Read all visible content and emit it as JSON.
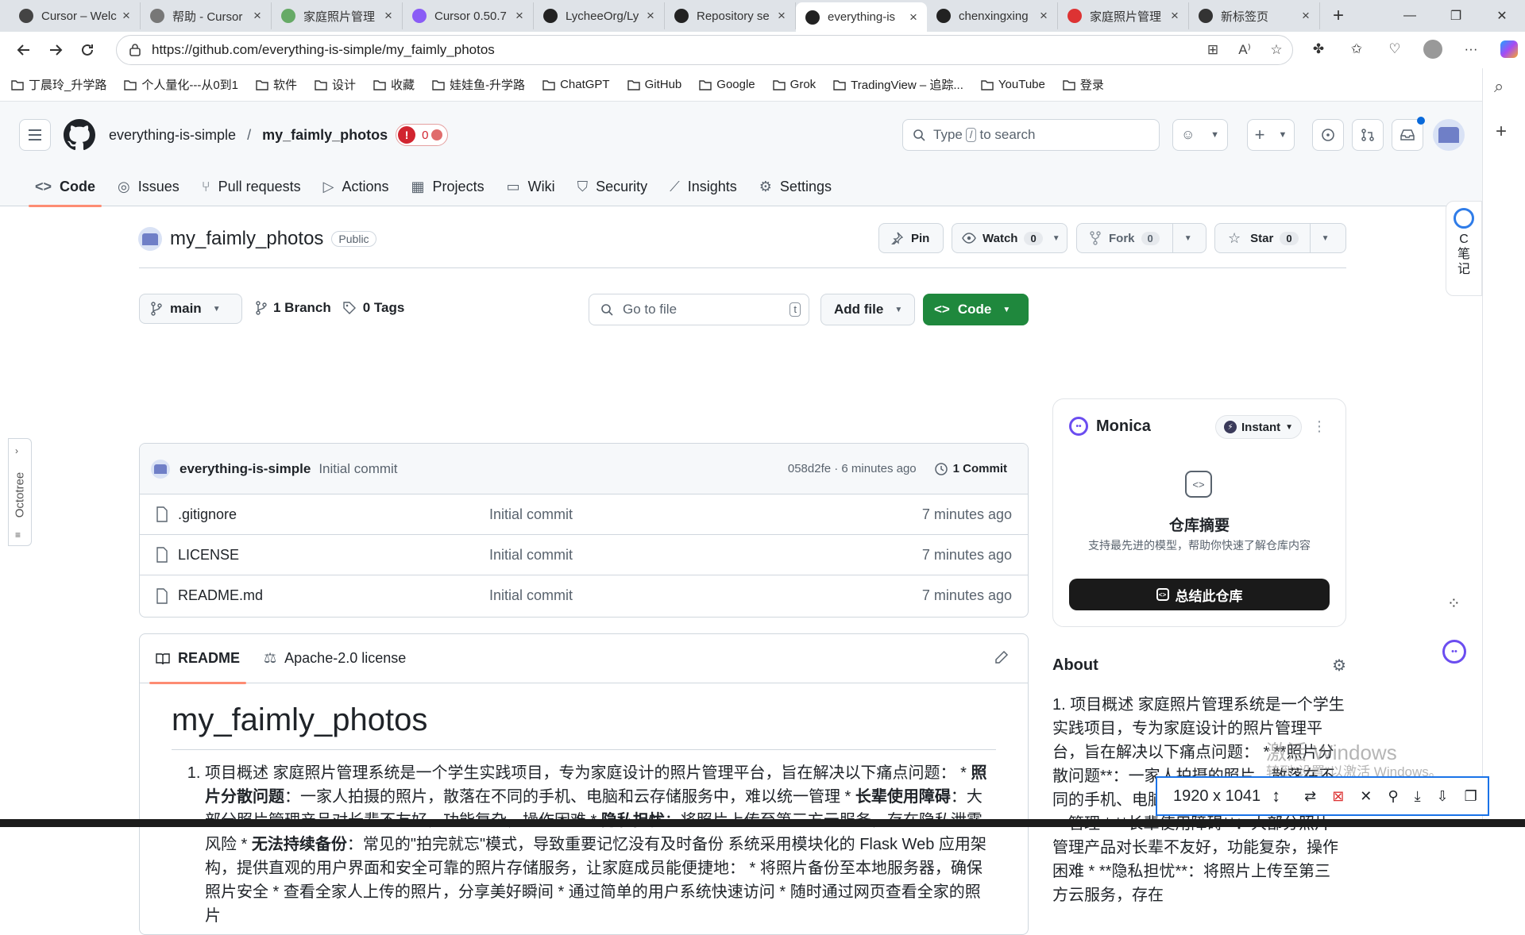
{
  "browser": {
    "tabs": [
      {
        "title": "Cursor – Welc",
        "color": "#444"
      },
      {
        "title": "帮助 - Cursor",
        "color": "#777"
      },
      {
        "title": "家庭照片管理",
        "color": "#6a6"
      },
      {
        "title": "Cursor 0.50.7",
        "color": "#8a5cf6"
      },
      {
        "title": "LycheeOrg/Ly",
        "color": "#222"
      },
      {
        "title": "Repository se",
        "color": "#222"
      },
      {
        "title": "everything-is",
        "color": "#222",
        "active": true
      },
      {
        "title": "chenxingxing",
        "color": "#222"
      },
      {
        "title": "家庭照片管理",
        "color": "#d33"
      },
      {
        "title": "新标签页",
        "color": "#333"
      }
    ],
    "url": "https://github.com/everything-is-simple/my_faimly_photos",
    "bookmarks": [
      "丁晨玲_升学路",
      "个人量化---从0到1",
      "软件",
      "设计",
      "收藏",
      "娃娃鱼-升学路",
      "ChatGPT",
      "GitHub",
      "Google",
      "Grok",
      "TradingView – 追踪...",
      "YouTube",
      "登录"
    ]
  },
  "github": {
    "owner": "everything-is-simple",
    "repo": "my_faimly_photos",
    "badge_count": "0",
    "search_placeholder_pre": "Type",
    "search_key": "/",
    "search_placeholder_post": "to search",
    "nav": [
      "Code",
      "Issues",
      "Pull requests",
      "Actions",
      "Projects",
      "Wiki",
      "Security",
      "Insights",
      "Settings"
    ],
    "visibility": "Public",
    "pin": "Pin",
    "watch": "Watch",
    "watch_count": "0",
    "fork": "Fork",
    "fork_count": "0",
    "star": "Star",
    "star_count": "0",
    "branch": "main",
    "branches": "1 Branch",
    "tags": "0 Tags",
    "goto_file": "Go to file",
    "goto_key": "t",
    "add_file": "Add file",
    "code_btn": "Code",
    "commit_author": "everything-is-simple",
    "commit_msg": "Initial commit",
    "commit_hash": "058d2fe · 6 minutes ago",
    "commit_count": "1 Commit",
    "files": [
      {
        "name": ".gitignore",
        "msg": "Initial commit",
        "time": "7 minutes ago"
      },
      {
        "name": "LICENSE",
        "msg": "Initial commit",
        "time": "7 minutes ago"
      },
      {
        "name": "README.md",
        "msg": "Initial commit",
        "time": "7 minutes ago"
      }
    ],
    "readme_tab": "README",
    "license_tab": "Apache-2.0 license",
    "readme_title": "my_faimly_photos",
    "readme_item": "项目概述 家庭照片管理系统是一个学生实践项目，专为家庭设计的照片管理平台，旨在解决以下痛点问题：",
    "readme_b1": "照片分散问题",
    "readme_t1": "：一家人拍摄的照片，散落在不同的手机、电脑和云存储服务中，难以统一管理 * ",
    "readme_b2": "长辈使用障碍",
    "readme_t2": "：大部分照片管理产品对长辈不友好，功能复杂，操作困难 * ",
    "readme_b3": "隐私担忧",
    "readme_t3": "：将照片上传至第三方云服务，存在隐私泄露风险 * ",
    "readme_b4": "无法持续备份",
    "readme_t4": "：常见的\"拍完就忘\"模式，导致重要记忆没有及时备份 系统采用模块化的 Flask Web 应用架构，提供直观的用户界面和安全可靠的照片存储服务，让家庭成员能便捷地： * 将照片备份至本地服务器，确保照片安全 * 查看全家人上传的照片，分享美好瞬间 * 通过简单的用户系统快速访问 * 随时通过网页查看全家的照片",
    "about_title": "About",
    "about_text": "1. 项目概述 家庭照片管理系统是一个学生实践项目，专为家庭设计的照片管理平台，旨在解决以下痛点问题： * **照片分散问题**：一家人拍摄的照片，散落在不同的手机、电脑和云存储服务中，难以统一管理 * **长辈使用障碍**：大部分照片管理产品对长辈不友好，功能复杂，操作困难 * **隐私担忧**：将照片上传至第三方云服务，存在"
  },
  "monica": {
    "name": "Monica",
    "mode": "Instant",
    "title": "仓库摘要",
    "subtitle": "支持最先进的模型，帮助你快速了解仓库内容",
    "button": "总结此仓库"
  },
  "side_note": "C\n笔\n记",
  "octotree": "Octotree",
  "capture": {
    "size": "1920 x 1041"
  },
  "watermark": {
    "line1": "激活 Windows",
    "line2": "转到\"设置\"以激活 Windows。"
  }
}
